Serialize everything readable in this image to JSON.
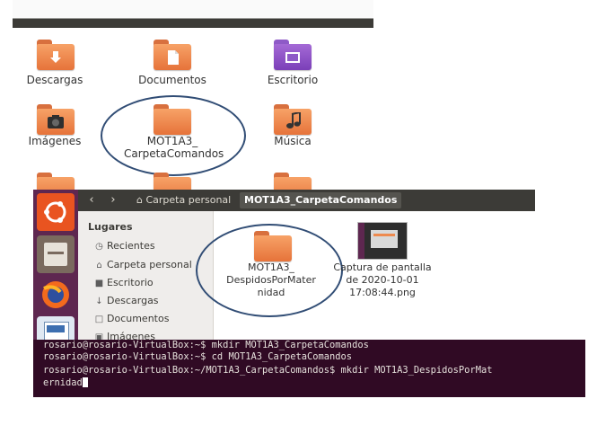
{
  "desktop_icons": [
    {
      "label": "Descargas",
      "icon": "downloads-folder-icon"
    },
    {
      "label": "Documentos",
      "icon": "documents-folder-icon"
    },
    {
      "label": "Escritorio",
      "icon": "desktop-folder-icon"
    },
    {
      "label": "Imágenes",
      "icon": "pictures-folder-icon"
    },
    {
      "label": "MOT1A3_\nCarpetaComandos",
      "icon": "folder-icon"
    },
    {
      "label": "Música",
      "icon": "music-folder-icon"
    }
  ],
  "file_manager": {
    "breadcrumb_home": "Carpeta personal",
    "breadcrumb_current": "MOT1A3_CarpetaComandos",
    "sidebar_title": "Lugares",
    "sidebar_items": [
      {
        "label": "Recientes",
        "icon": "clock-icon"
      },
      {
        "label": "Carpeta personal",
        "icon": "home-icon"
      },
      {
        "label": "Escritorio",
        "icon": "desktop-icon"
      },
      {
        "label": "Descargas",
        "icon": "download-icon"
      },
      {
        "label": "Documentos",
        "icon": "document-icon"
      },
      {
        "label": "Imágenes",
        "icon": "camera-icon"
      }
    ],
    "files": [
      {
        "label": "MOT1A3_\nDespidosPorMater\nnidad",
        "icon": "folder-icon"
      },
      {
        "label": "Captura de pantalla\nde 2020-10-01\n17:08:44.png",
        "icon": "image-thumbnail"
      }
    ]
  },
  "terminal": {
    "lines": [
      "rosario@rosario-VirtualBox:~$ mkdir MOT1A3_CarpetaComandos",
      "rosario@rosario-VirtualBox:~$ cd MOT1A3_CarpetaComandos",
      "rosario@rosario-VirtualBox:~/MOT1A3_CarpetaComandos$ mkdir MOT1A3_DespidosPorMat",
      "ernidad"
    ]
  },
  "colors": {
    "folder_orange": "#ee8a4f",
    "launcher": "#5e2750",
    "terminal_bg": "#300a24",
    "highlight_ellipse": "#314d75"
  }
}
